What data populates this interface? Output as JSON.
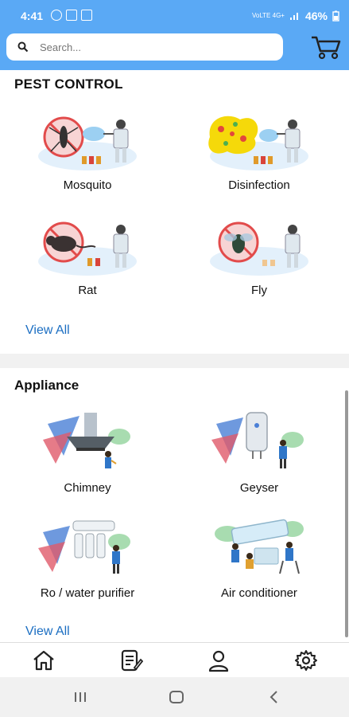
{
  "status": {
    "time": "4:41",
    "network": "VoLTE 4G+",
    "battery": "46%"
  },
  "search": {
    "placeholder": "Search..."
  },
  "pest_control": {
    "title": "PEST CONTROL",
    "items": [
      {
        "label": "Mosquito",
        "icon": "mosquito-spray-illustration"
      },
      {
        "label": "Disinfection",
        "icon": "disinfection-spray-illustration"
      },
      {
        "label": "Rat",
        "icon": "rat-spray-illustration"
      },
      {
        "label": "Fly",
        "icon": "fly-spray-illustration"
      }
    ],
    "view_all": "View All"
  },
  "appliance": {
    "title": "Appliance",
    "items": [
      {
        "label": "Chimney",
        "icon": "chimney-repair-illustration"
      },
      {
        "label": "Geyser",
        "icon": "geyser-repair-illustration"
      },
      {
        "label": "Ro / water purifier",
        "icon": "water-purifier-repair-illustration"
      },
      {
        "label": "Air conditioner",
        "icon": "ac-repair-illustration"
      }
    ],
    "view_all": "View All"
  },
  "bottom_nav": [
    "home-icon",
    "orders-icon",
    "profile-icon",
    "settings-icon"
  ],
  "colors": {
    "header": "#5aa9f5",
    "link": "#1b6ec2"
  }
}
